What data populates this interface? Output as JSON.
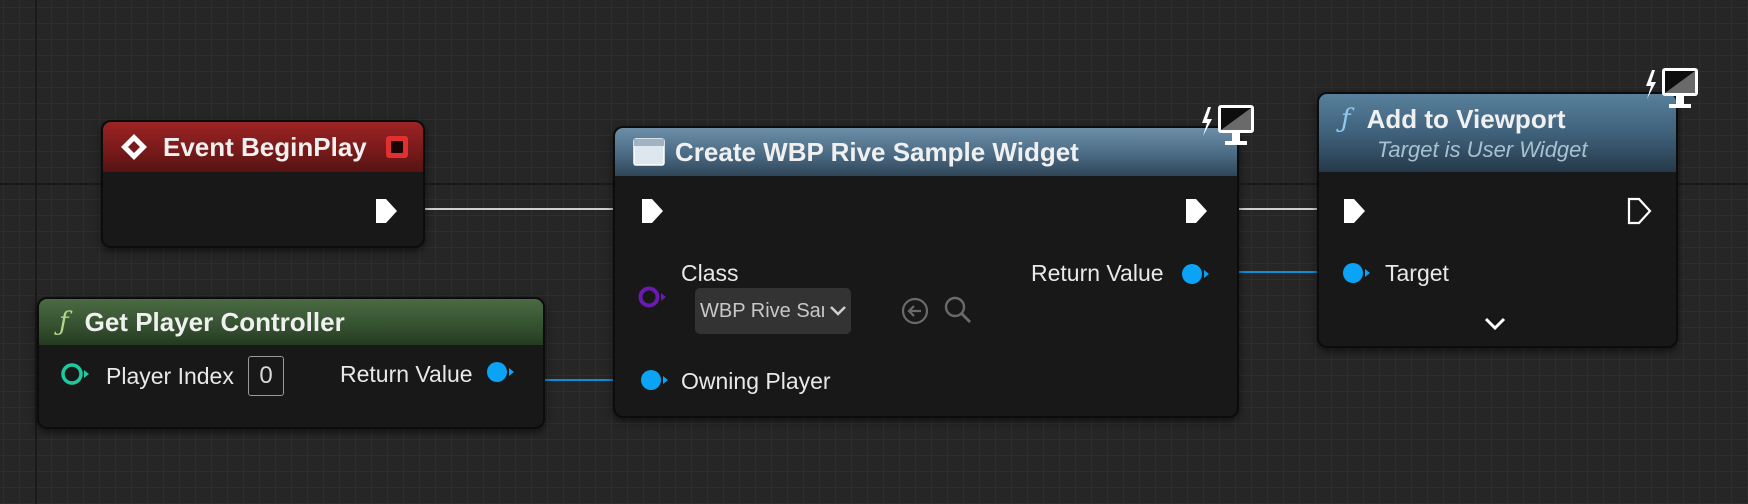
{
  "nodes": {
    "event_begin_play": {
      "title": "Event BeginPlay"
    },
    "get_player_controller": {
      "title": "Get Player Controller",
      "player_index_label": "Player Index",
      "player_index_value": "0",
      "return_value_label": "Return Value"
    },
    "create_widget": {
      "title": "Create WBP Rive Sample Widget",
      "class_label": "Class",
      "class_value": "WBP Rive Sampl",
      "return_value_label": "Return Value",
      "owning_player_label": "Owning Player"
    },
    "add_to_viewport": {
      "title": "Add to Viewport",
      "subtitle": "Target is User Widget",
      "target_label": "Target"
    }
  },
  "colors": {
    "event_header": "#8a1f1f",
    "function_green_header": "#3c5a37",
    "function_blue_header": "#52728c",
    "object_pin": "#0aa3f5",
    "class_pin": "#6a1ab0",
    "int_pin": "#1fc9a0",
    "exec_pin": "#ffffff"
  }
}
